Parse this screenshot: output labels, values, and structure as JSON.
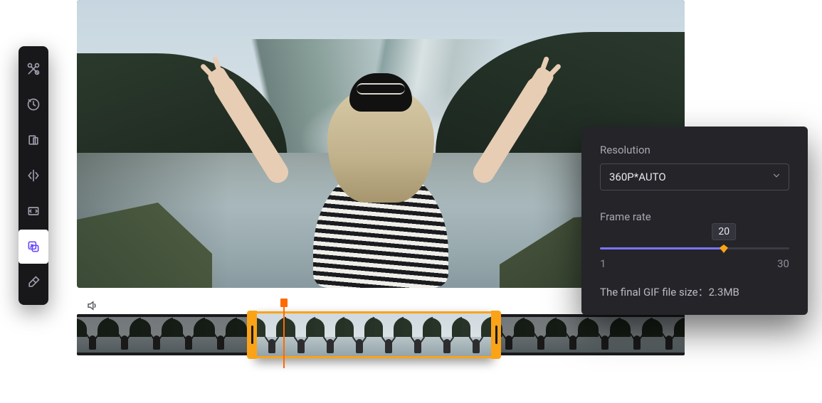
{
  "sidebar": {
    "tools": [
      {
        "name": "cut-tool-icon"
      },
      {
        "name": "speed-tool-icon"
      },
      {
        "name": "crop-tool-icon"
      },
      {
        "name": "mirror-tool-icon"
      },
      {
        "name": "resize-tool-icon"
      },
      {
        "name": "export-tool-icon",
        "active": true
      },
      {
        "name": "erase-tool-icon"
      }
    ]
  },
  "controls": {
    "volume": "volume-icon"
  },
  "timeline": {
    "frame_count": 19,
    "selection_start_frame": 6,
    "selection_end_frame": 13,
    "playhead_frame": 7
  },
  "panel": {
    "resolution_label": "Resolution",
    "resolution_value": "360P*AUTO",
    "framerate_label": "Frame rate",
    "framerate_value": "20",
    "framerate_min": "1",
    "framerate_max": "30",
    "filesize_label": "The final GIF file size：",
    "filesize_value": "2.3MB",
    "accent_color": "#7a74ff",
    "selection_color": "#fba317"
  }
}
